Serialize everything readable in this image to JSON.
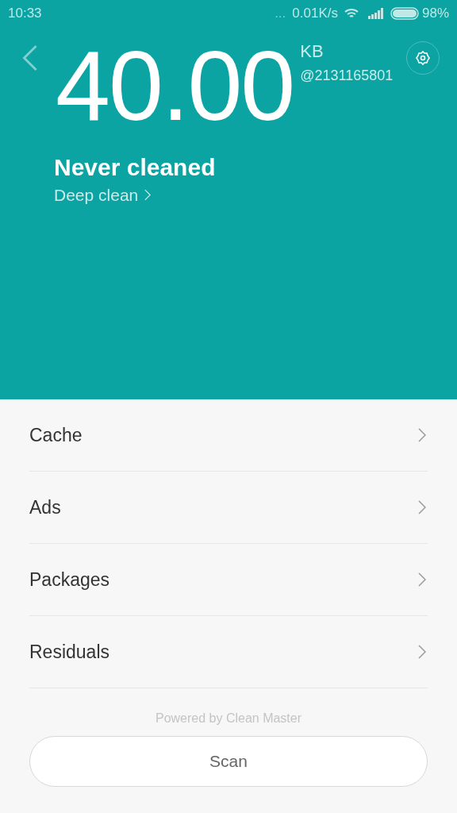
{
  "status_bar": {
    "time": "10:33",
    "dots": "...",
    "speed": "0.01K/s",
    "battery": "98%"
  },
  "header": {
    "size": "40.00",
    "unit": "KB",
    "account": "@2131165801",
    "status": "Never cleaned",
    "link": "Deep clean"
  },
  "items": [
    {
      "label": "Cache"
    },
    {
      "label": "Ads"
    },
    {
      "label": "Packages"
    },
    {
      "label": "Residuals"
    }
  ],
  "footer": "Powered by Clean Master",
  "button": "Scan"
}
